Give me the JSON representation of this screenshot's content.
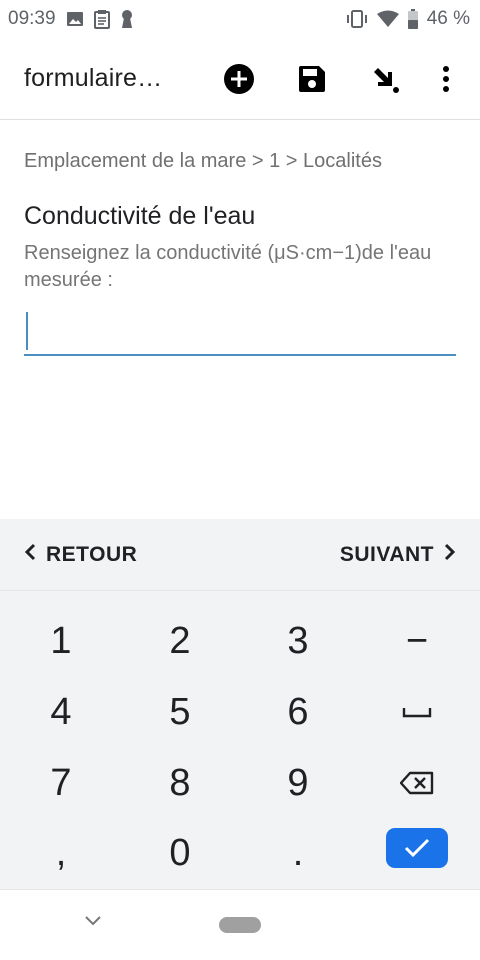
{
  "status_bar": {
    "time": "09:39",
    "battery_percent": "46 %",
    "icons": [
      "image-icon",
      "clipboard-icon",
      "keyhole-icon",
      "vibrate-icon",
      "wifi-icon",
      "battery-icon"
    ]
  },
  "app_bar": {
    "title": "formulaire…",
    "actions": [
      "add-icon",
      "save-icon",
      "arrow-down-right-icon",
      "more-vert-icon"
    ]
  },
  "content": {
    "breadcrumb": "Emplacement de la mare > 1 > Localités",
    "question_title": "Conductivité de l'eau",
    "question_hint": "Renseignez la conductivité (μS·cm−1)de l'eau mesurée :",
    "input_value": "",
    "input_placeholder": ""
  },
  "navigation": {
    "back_label": "RETOUR",
    "next_label": "SUIVANT"
  },
  "keyboard": {
    "keys": [
      "1",
      "2",
      "3",
      "−",
      "4",
      "5",
      "6",
      "␣",
      "7",
      "8",
      "9",
      "⌫",
      ",",
      "0",
      ".",
      "✓"
    ]
  },
  "colors": {
    "accent": "#4a8fc1",
    "enter_key": "#1a73e8",
    "keyboard_bg": "#f1f3f4"
  }
}
